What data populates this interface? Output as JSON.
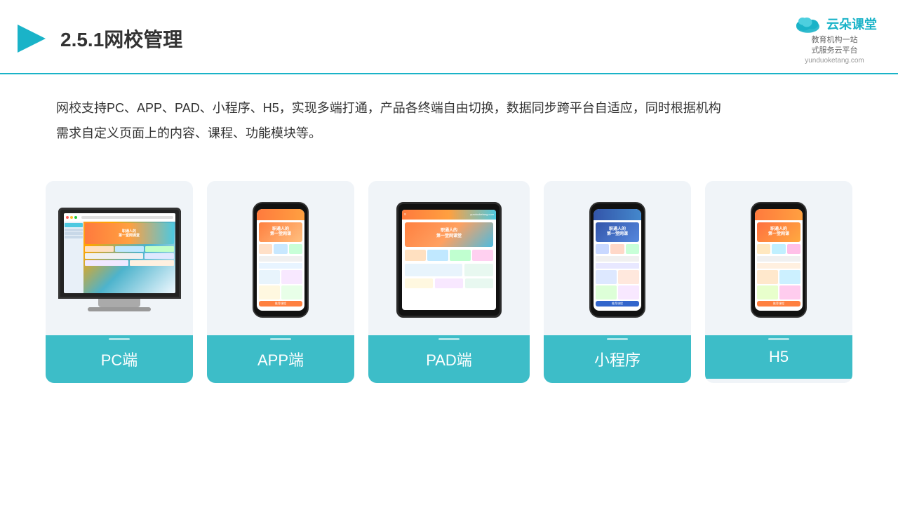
{
  "header": {
    "title": "2.5.1网校管理",
    "logo_main": "云朵课堂",
    "logo_url": "yunduoketang.com",
    "logo_tagline": "教育机构一站\n式服务云平台"
  },
  "description": "网校支持PC、APP、PAD、小程序、H5，实现多端打通，产品各终端自由切换，数据同步跨平台自适应，同时根据机构\n需求自定义页面上的内容、课程、功能模块等。",
  "cards": [
    {
      "id": "pc",
      "label": "PC端"
    },
    {
      "id": "app",
      "label": "APP端"
    },
    {
      "id": "pad",
      "label": "PAD端"
    },
    {
      "id": "miniprogram",
      "label": "小程序"
    },
    {
      "id": "h5",
      "label": "H5"
    }
  ],
  "colors": {
    "accent": "#1ab3c8",
    "card_bg": "#f0f4f8",
    "card_label_bg": "#3dbdc8",
    "title_color": "#333333"
  }
}
